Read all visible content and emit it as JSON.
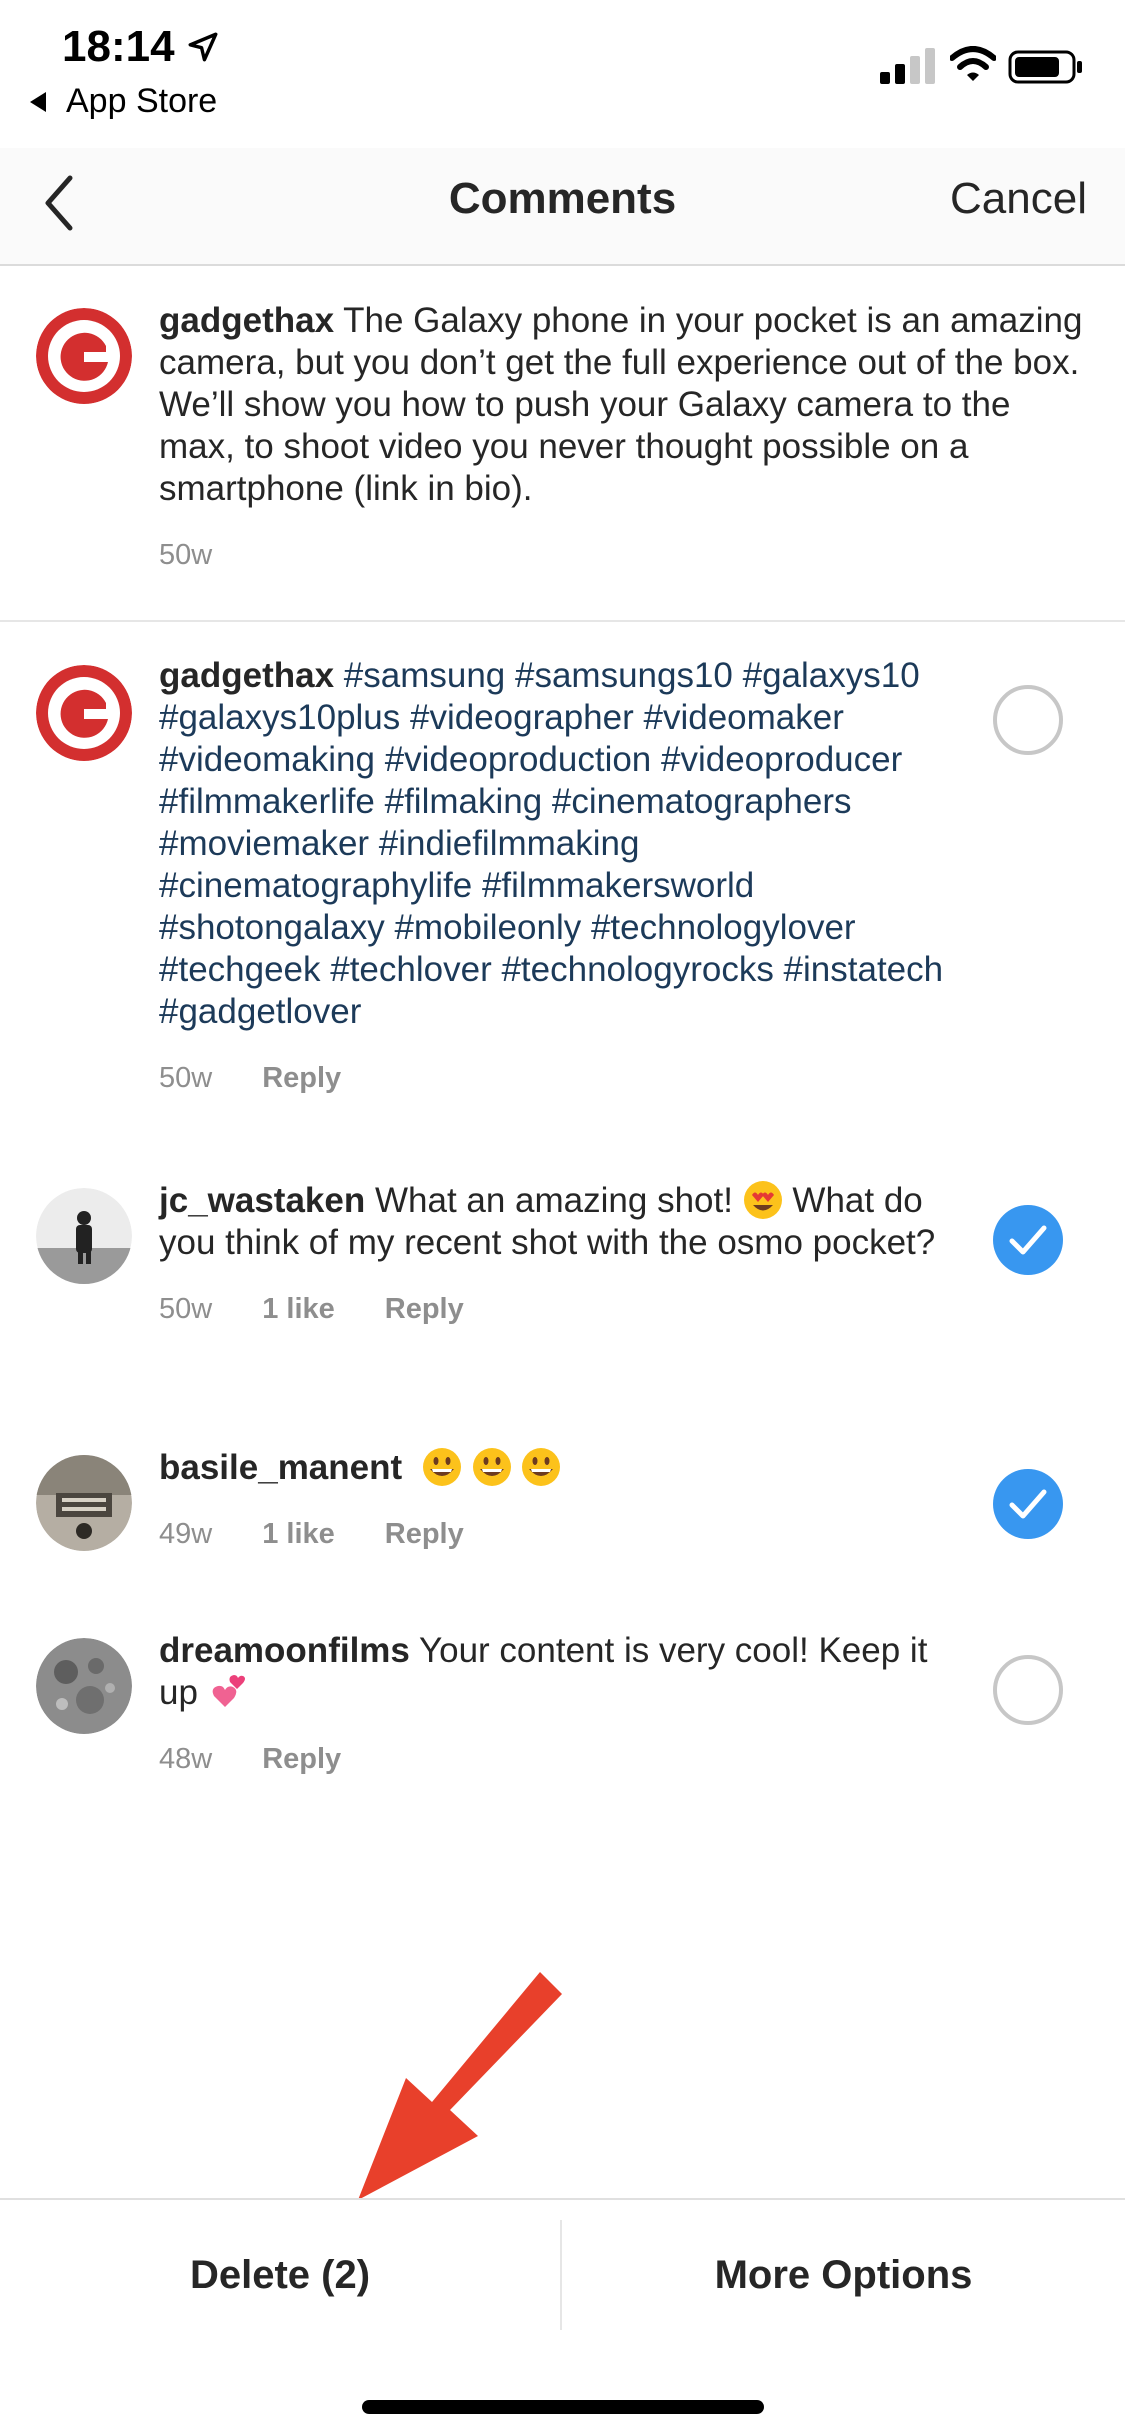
{
  "status_bar": {
    "time": "18:14",
    "back_app": "App Store"
  },
  "nav": {
    "title": "Comments",
    "cancel": "Cancel"
  },
  "comments": [
    {
      "username": "gadgethax",
      "text": "The Galaxy phone in your pocket is an amazing camera, but you don’t get the full experience out of the box. We’ll show you how to push your Galaxy camera to the max, to shoot video you never thought possible on a smartphone (link in bio).",
      "age": "50w",
      "selectable": false
    },
    {
      "username": "gadgethax",
      "text": "#samsung #samsungs10 #galaxys10 #galaxys10plus #videographer #videomaker #videomaking #videoproduction #videoproducer #filmmakerlife #filmaking #cinematographers #moviemaker #indiefilmmaking #cinematographylife #filmmakersworld #shotongalaxy #mobileonly #technologylover #techgeek #techlover #technologyrocks #instatech #gadgetlover",
      "age": "50w",
      "reply": "Reply",
      "selected": false
    },
    {
      "username": "jc_wastaken",
      "text_before_emoji": "What an amazing shot!",
      "text_after_emoji": "What do you think of my recent shot with the osmo pocket?",
      "age": "50w",
      "likes": "1 like",
      "reply": "Reply",
      "selected": true
    },
    {
      "username": "basile_manent",
      "age": "49w",
      "likes": "1 like",
      "reply": "Reply",
      "selected": true
    },
    {
      "username": "dreamoonfilms",
      "text": "Your content is very cool! Keep it up",
      "age": "48w",
      "reply": "Reply",
      "selected": false
    }
  ],
  "bottom_bar": {
    "delete": "Delete (2)",
    "more_options": "More Options"
  },
  "colors": {
    "accent_blue": "#3897f0",
    "hashtag": "#1c3a59",
    "meta_gray": "#8e8e8e",
    "gadgethax_red": "#d32f2f",
    "annotation_arrow": "#e8402b"
  }
}
